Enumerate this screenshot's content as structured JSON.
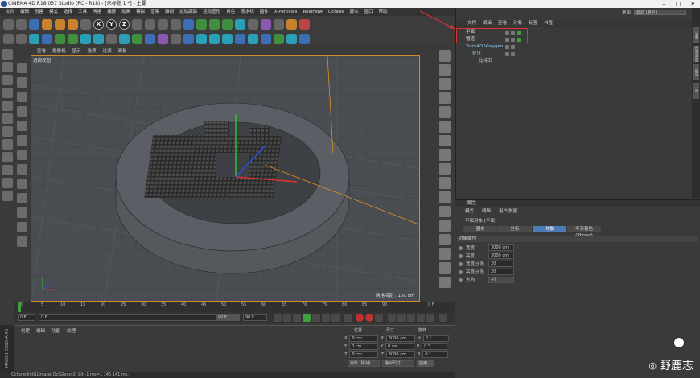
{
  "window": {
    "title": "CINEMA 4D R18.057 Studio (RC - R18) - [未标题 1 *] - 主要"
  },
  "menubar": [
    "文件",
    "编辑",
    "创建",
    "模式",
    "选择",
    "工具",
    "网格",
    "捕捉",
    "动画",
    "模拟",
    "渲染",
    "雕刻",
    "运动跟踪",
    "运动图形",
    "角色",
    "流水线",
    "插件",
    "X-Particles",
    "RealFlow",
    "Octane",
    "脚本",
    "窗口",
    "帮助"
  ],
  "toolbar": {
    "axes": [
      "X",
      "Y",
      "Z"
    ]
  },
  "viewport": {
    "menu": [
      "查看",
      "摄像机",
      "显示",
      "选项",
      "过滤",
      "面板"
    ],
    "label": "透视视图",
    "grid_label": "网格间距 : 100 cm"
  },
  "timeline": {
    "ticks": [
      "0",
      "5",
      "10",
      "15",
      "20",
      "25",
      "30",
      "35",
      "40",
      "45",
      "50",
      "55",
      "60",
      "65",
      "70",
      "75",
      "80",
      "85",
      "90"
    ],
    "end_frame": "0 F"
  },
  "transport": {
    "start": "0 F",
    "current": "0 F",
    "end": "90 F",
    "max": "90 F"
  },
  "material_manager": {
    "menu": [
      "创建",
      "编辑",
      "功能",
      "纹理"
    ]
  },
  "coordinates": {
    "headers": [
      "位置",
      "尺寸",
      "旋转"
    ],
    "rows": [
      {
        "axis": "X",
        "pos": "0 cm",
        "size": "3000 cm",
        "rot_axis": "H",
        "rot": "0 °"
      },
      {
        "axis": "Y",
        "pos": "0 cm",
        "size": "0 cm",
        "rot_axis": "P",
        "rot": "0 °"
      },
      {
        "axis": "Z",
        "pos": "0 cm",
        "size": "3000 cm",
        "rot_axis": "B",
        "rot": "0 °"
      }
    ],
    "mode_select": "对象 (相对)",
    "size_select": "绝对尺寸",
    "apply": "应用"
  },
  "statusbar": "Octane:InitGLImage:OctGlossy2: bit:-1 res=1  145 141 ms.",
  "maxon": "MAXON CINEMA 4D",
  "object_manager": {
    "layout_label": "界面",
    "layout_value": "启动 (用户)",
    "menu": [
      "文件",
      "编辑",
      "查看",
      "对象",
      "标签",
      "书签"
    ],
    "objects": [
      {
        "name": "平面",
        "indent": 0,
        "color": "#e0e0e0"
      },
      {
        "name": "管道",
        "indent": 0,
        "color": "#e0e0e0"
      },
      {
        "name": "Tools4D Voxygen",
        "indent": 0,
        "color": "#8fd0ff"
      },
      {
        "name": "挤压",
        "indent": 1,
        "color": "#9fe09f"
      },
      {
        "name": "比特币",
        "indent": 2,
        "color": "#e0e0e0"
      }
    ]
  },
  "attributes": {
    "header": "属性",
    "menu": [
      "模式",
      "编辑",
      "用户数据"
    ],
    "object_title": "平面对象 [平面]",
    "tabs": [
      "基本",
      "坐标",
      "对象",
      "平滑着色(Phong)"
    ],
    "active_tab": 2,
    "section": "对象属性",
    "props": [
      {
        "label": "宽度",
        "value": "3000 cm"
      },
      {
        "label": "高度",
        "value": "3000 cm"
      },
      {
        "label": "宽度分段",
        "value": "20"
      },
      {
        "label": "高度分段",
        "value": "20"
      },
      {
        "label": "方向",
        "value": "+Y"
      }
    ]
  },
  "side_tabs": [
    "对象",
    "内容浏览器",
    "构造",
    "层"
  ],
  "watermark": {
    "text": "野鹿志"
  }
}
